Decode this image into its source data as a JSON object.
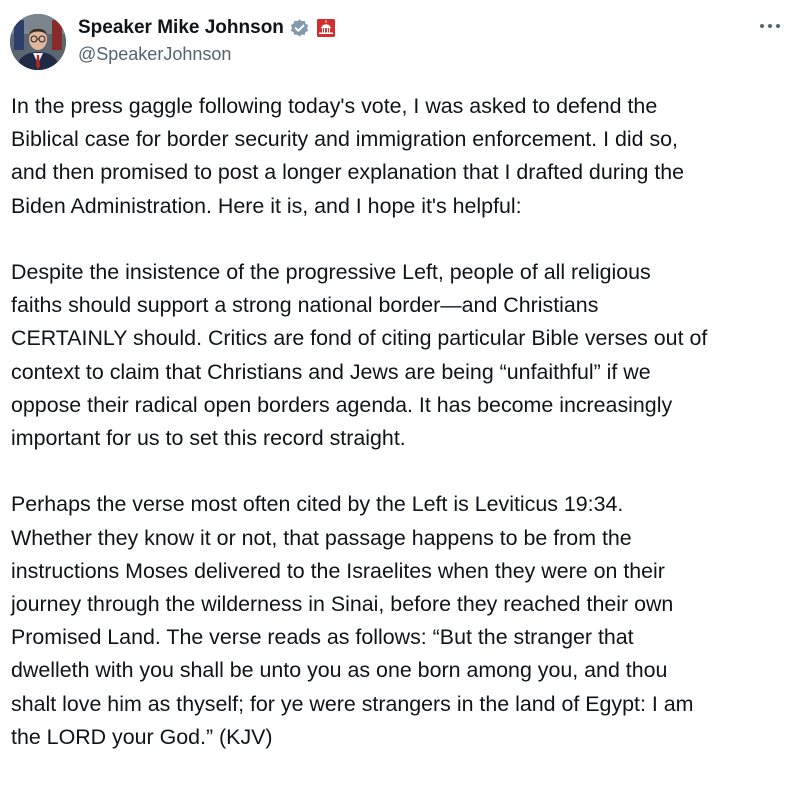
{
  "author": {
    "display_name": "Speaker Mike Johnson",
    "handle": "@SpeakerJohnson",
    "verified_icon": "gray-verified-badge-icon",
    "affiliation_icon": "capitol-dome-badge-icon",
    "affiliation_color": "#d32f2f",
    "verified_color": "#829aab"
  },
  "menu": {
    "more_icon": "more-options-icon"
  },
  "post": {
    "paragraphs": [
      "In the press gaggle following today's vote, I was asked to defend the\nBiblical case for border security and immigration enforcement. I did so,\nand then promised to post a longer explanation that I drafted during the\nBiden Administration. Here it is, and I hope it's helpful:",
      "Despite the insistence of the progressive Left, people of all religious\nfaiths should support a strong national border—and Christians\nCERTAINLY should. Critics are fond of citing particular Bible verses out of\ncontext to claim that Christians and Jews are being “unfaithful” if we\noppose their radical open borders agenda. It has become increasingly\nimportant for us to set this record straight.",
      "Perhaps the verse most often cited by the Left is Leviticus 19:34.\nWhether they know it or not, that passage happens to be from the\ninstructions Moses delivered to the Israelites when they were on their\njourney through the wilderness in Sinai, before they reached their own\nPromised Land. The verse reads as follows: “But the stranger that\ndwelleth with you shall be unto you as one born among you, and thou\nshalt love him as thyself; for ye were strangers in the land of Egypt: I am\nthe LORD your God.” (KJV)"
    ]
  }
}
